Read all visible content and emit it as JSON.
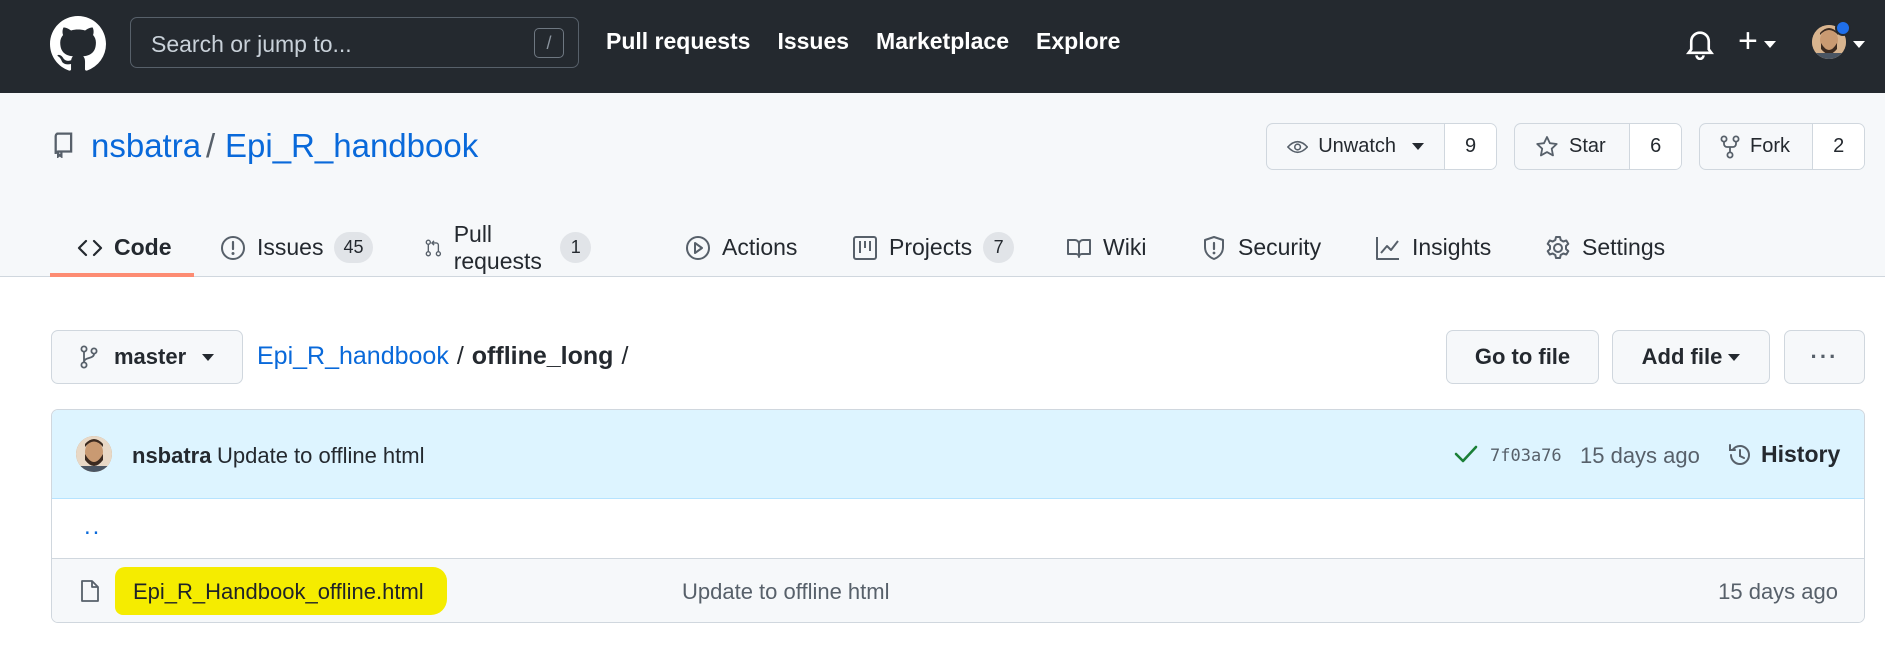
{
  "header": {
    "search_placeholder": "Search or jump to...",
    "search_shortcut": "/",
    "nav": [
      "Pull requests",
      "Issues",
      "Marketplace",
      "Explore"
    ],
    "plus_label": "+"
  },
  "repo": {
    "owner": "nsbatra",
    "separator": "/",
    "name": "Epi_R_handbook",
    "watch_label": "Unwatch",
    "watch_count": "9",
    "star_label": "Star",
    "star_count": "6",
    "fork_label": "Fork",
    "fork_count": "2"
  },
  "tabs": {
    "code": "Code",
    "issues": "Issues",
    "issues_count": "45",
    "pulls": "Pull requests",
    "pulls_count": "1",
    "actions": "Actions",
    "projects": "Projects",
    "projects_count": "7",
    "wiki": "Wiki",
    "security": "Security",
    "insights": "Insights",
    "settings": "Settings"
  },
  "filenav": {
    "branch": "master",
    "crumb_root": "Epi_R_handbook",
    "crumb_sep": "/",
    "crumb_current": "offline_long",
    "crumb_trailing": "/",
    "go_to_file": "Go to file",
    "add_file": "Add file",
    "more": "···"
  },
  "commit": {
    "author": "nsbatra",
    "message": "Update to offline html",
    "sha": "7f03a76",
    "time": "15 days ago",
    "history": "History"
  },
  "files": {
    "parent": "..",
    "rows": [
      {
        "name": "Epi_R_Handbook_offline.html",
        "message": "Update to offline html",
        "time": "15 days ago"
      }
    ]
  },
  "colors": {
    "header_bg": "#24292f",
    "link": "#0969da",
    "tab_underline": "#fd8c73",
    "highlight": "#f5ec00",
    "commit_bg": "#ddf4ff",
    "success": "#1a7f37"
  }
}
